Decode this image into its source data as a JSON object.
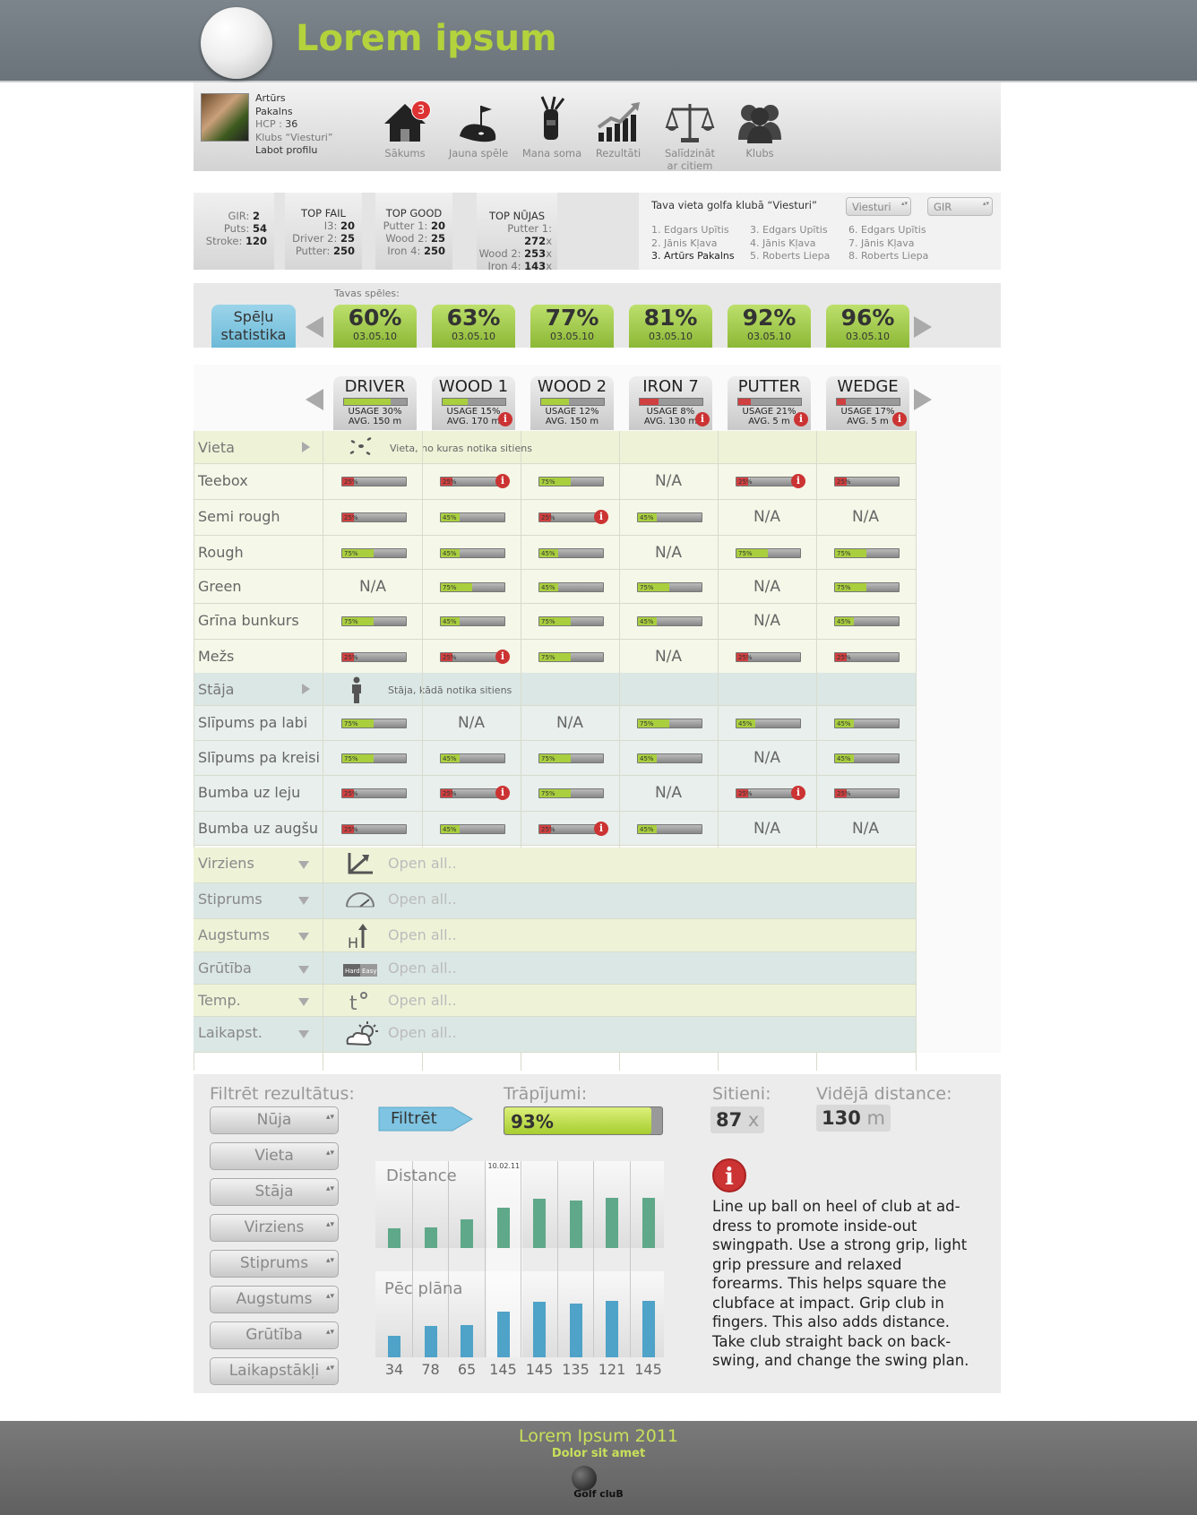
{
  "header": {
    "title": "Lorem ipsum"
  },
  "profile": {
    "first_name": "Artūrs",
    "last_name": "Pakalns",
    "hcp_label": "HCP :",
    "hcp": "36",
    "club_label": "Klubs “Viesturi”",
    "edit": "Labot profilu"
  },
  "nav": [
    {
      "label": "Sākums",
      "badge": "3",
      "icon": "home-icon"
    },
    {
      "label": "Jauna spēle",
      "icon": "golf-green-icon"
    },
    {
      "label": "Mana soma",
      "icon": "golf-bag-icon"
    },
    {
      "label": "Rezultāti",
      "icon": "chart-trend-icon"
    },
    {
      "label": "Salīdzināt ar citiem",
      "icon": "scales-icon"
    },
    {
      "label": "Klubs",
      "icon": "people-icon"
    }
  ],
  "stats": {
    "gir_label": "GIR:",
    "gir": "2",
    "puts_label": "Puts:",
    "puts": "54",
    "stroke_label": "Stroke:",
    "stroke": "120"
  },
  "top_fail": {
    "title": "TOP FAIL",
    "rows": [
      {
        "k": "I3:",
        "v": "20"
      },
      {
        "k": "Driver 2:",
        "v": "25"
      },
      {
        "k": "Putter:",
        "v": "250"
      }
    ]
  },
  "top_good": {
    "title": "TOP GOOD",
    "rows": [
      {
        "k": "Putter 1:",
        "v": "20"
      },
      {
        "k": "Wood 2:",
        "v": "25"
      },
      {
        "k": "Iron 4:",
        "v": "250"
      }
    ]
  },
  "top_clubs": {
    "title": "TOP NŪJAS",
    "rows": [
      {
        "k": "Putter 1:",
        "v": "272",
        "u": "x"
      },
      {
        "k": "Wood 2:",
        "v": "253",
        "u": "x"
      },
      {
        "k": "Iron 4:",
        "v": "143",
        "u": "x"
      }
    ]
  },
  "ranking": {
    "title": "Tava vieta golfa klubā “Viesturi”",
    "select1": "Viesturi",
    "select2": "GIR",
    "cols": [
      [
        "1. Edgars Upītis",
        "2. Jānis Kļava",
        "3. Artūrs Pakalns"
      ],
      [
        "3. Edgars Upītis",
        "4. Jānis Kļava",
        "5. Roberts Liepa"
      ],
      [
        "6. Edgars Upītis",
        "7. Jānis Kļava",
        "8. Roberts Liepa"
      ]
    ]
  },
  "games": {
    "label": "Tavas spēles:",
    "tab": "Spēļu statistika",
    "items": [
      {
        "pct": "60%",
        "date": "03.05.10"
      },
      {
        "pct": "63%",
        "date": "03.05.10"
      },
      {
        "pct": "77%",
        "date": "03.05.10"
      },
      {
        "pct": "81%",
        "date": "03.05.10"
      },
      {
        "pct": "92%",
        "date": "03.05.10"
      },
      {
        "pct": "96%",
        "date": "03.05.10"
      }
    ]
  },
  "clubs": [
    {
      "name": "DRIVER",
      "usage": "USAGE 30%",
      "avg": "AVG. 150 m",
      "level": 0.75,
      "color": "#a9cf3e",
      "info": false
    },
    {
      "name": "WOOD 1",
      "usage": "USAGE 15%",
      "avg": "AVG. 170 m",
      "level": 0.4,
      "color": "#a9cf3e",
      "info": true
    },
    {
      "name": "WOOD 2",
      "usage": "USAGE 12%",
      "avg": "AVG. 150 m",
      "level": 0.45,
      "color": "#a9cf3e",
      "info": false
    },
    {
      "name": "IRON 7",
      "usage": "USAGE 8%",
      "avg": "AVG. 130 m",
      "level": 0.3,
      "color": "#d04040",
      "info": true
    },
    {
      "name": "PUTTER",
      "usage": "USAGE 21%",
      "avg": "AVG. 5 m",
      "level": 0.2,
      "color": "#d04040",
      "info": true
    },
    {
      "name": "WEDGE",
      "usage": "USAGE 17%",
      "avg": "AVG. 5 m",
      "level": 0.15,
      "color": "#d04040",
      "info": true
    }
  ],
  "sections": {
    "vieta": {
      "label": "Vieta",
      "desc": "Vieta, no kuras notika sitiens"
    },
    "staja": {
      "label": "Stāja",
      "desc": "Stāja, kādā notika sitiens"
    }
  },
  "vieta_rows": [
    {
      "label": "Teebox",
      "cells": [
        "25%",
        "25%!",
        "75%",
        "N/A",
        "25%!",
        "25%"
      ]
    },
    {
      "label": "Semi rough",
      "cells": [
        "25%",
        "45%",
        "25%!",
        "45%",
        "N/A",
        "N/A"
      ]
    },
    {
      "label": "Rough",
      "cells": [
        "75%",
        "45%",
        "45%",
        "N/A",
        "75%",
        "75%"
      ]
    },
    {
      "label": "Green",
      "cells": [
        "N/A",
        "75%",
        "45%",
        "75%",
        "N/A",
        "75%"
      ]
    },
    {
      "label": "Grīna bunkurs",
      "cells": [
        "75%",
        "45%",
        "75%",
        "45%",
        "N/A",
        "45%"
      ]
    },
    {
      "label": "Mežs",
      "cells": [
        "25%",
        "25%!",
        "75%",
        "N/A",
        "25%",
        "25%"
      ]
    }
  ],
  "staja_rows": [
    {
      "label": "Slīpums pa labi",
      "cells": [
        "75%",
        "N/A",
        "N/A",
        "75%",
        "45%",
        "45%"
      ]
    },
    {
      "label": "Slīpums pa kreisi",
      "cells": [
        "75%",
        "45%",
        "75%",
        "45%",
        "N/A",
        "45%"
      ]
    },
    {
      "label": "Bumba uz leju",
      "cells": [
        "25%",
        "25%!",
        "75%",
        "N/A",
        "25%!",
        "25%"
      ]
    },
    {
      "label": "Bumba uz augšu",
      "cells": [
        "25%",
        "45%",
        "25%!",
        "45%",
        "N/A",
        "N/A"
      ]
    }
  ],
  "collapsed": [
    {
      "label": "Virziens",
      "icon": "direction-icon",
      "open": "Open all.."
    },
    {
      "label": "Stiprums",
      "icon": "speedometer-icon",
      "open": "Open all.."
    },
    {
      "label": "Augstums",
      "icon": "height-icon",
      "open": "Open all.."
    },
    {
      "label": "Grūtība",
      "icon": "difficulty-icon",
      "open": "Open all.."
    },
    {
      "label": "Temp.",
      "icon": "temperature-icon",
      "open": "Open all.."
    },
    {
      "label": "Laikapst.",
      "icon": "weather-icon",
      "open": "Open all.."
    }
  ],
  "na": "N/A",
  "filter": {
    "title": "Filtrēt rezultātus:",
    "button": "Filtrēt",
    "selects": [
      "Nūja",
      "Vieta",
      "Stāja",
      "Virziens",
      "Stiprums",
      "Augstums",
      "Grūtība",
      "Laikapstākļi"
    ],
    "hits_label": "Trāpījumi:",
    "hits": "93%",
    "hits_level": 0.93,
    "strokes_label": "Sitieni:",
    "strokes": "87",
    "strokes_unit": "x",
    "avgdist_label": "Vidējā distance:",
    "avgdist": "130",
    "avgdist_unit": "m"
  },
  "chart_data": {
    "type": "bar",
    "categories": [
      "34",
      "78",
      "65",
      "145",
      "145",
      "135",
      "121",
      "145"
    ],
    "highlight_label": "10.02.11",
    "series": [
      {
        "name": "Distance",
        "values": [
          34,
          36,
          50,
          71,
          86,
          83,
          87,
          87
        ]
      },
      {
        "name": "Pēc plāna",
        "values": [
          34,
          48,
          50,
          71,
          86,
          83,
          87,
          87
        ]
      }
    ],
    "color": [
      "#5fa889",
      "#4fa2c8"
    ]
  },
  "tip": "Line up ball on heel of club at ad- dress to promote inside-out swingpath. Use a strong grip, light grip pressure and relaxed forearms. This helps square the clubface at impact. Grip club in fingers. This also adds distance. Take club straight back on back- swing, and change the swing plan.",
  "footer": {
    "title": "Lorem Ipsum 2011",
    "sub": "Dolor sit amet",
    "logo": "Golf cluB"
  }
}
